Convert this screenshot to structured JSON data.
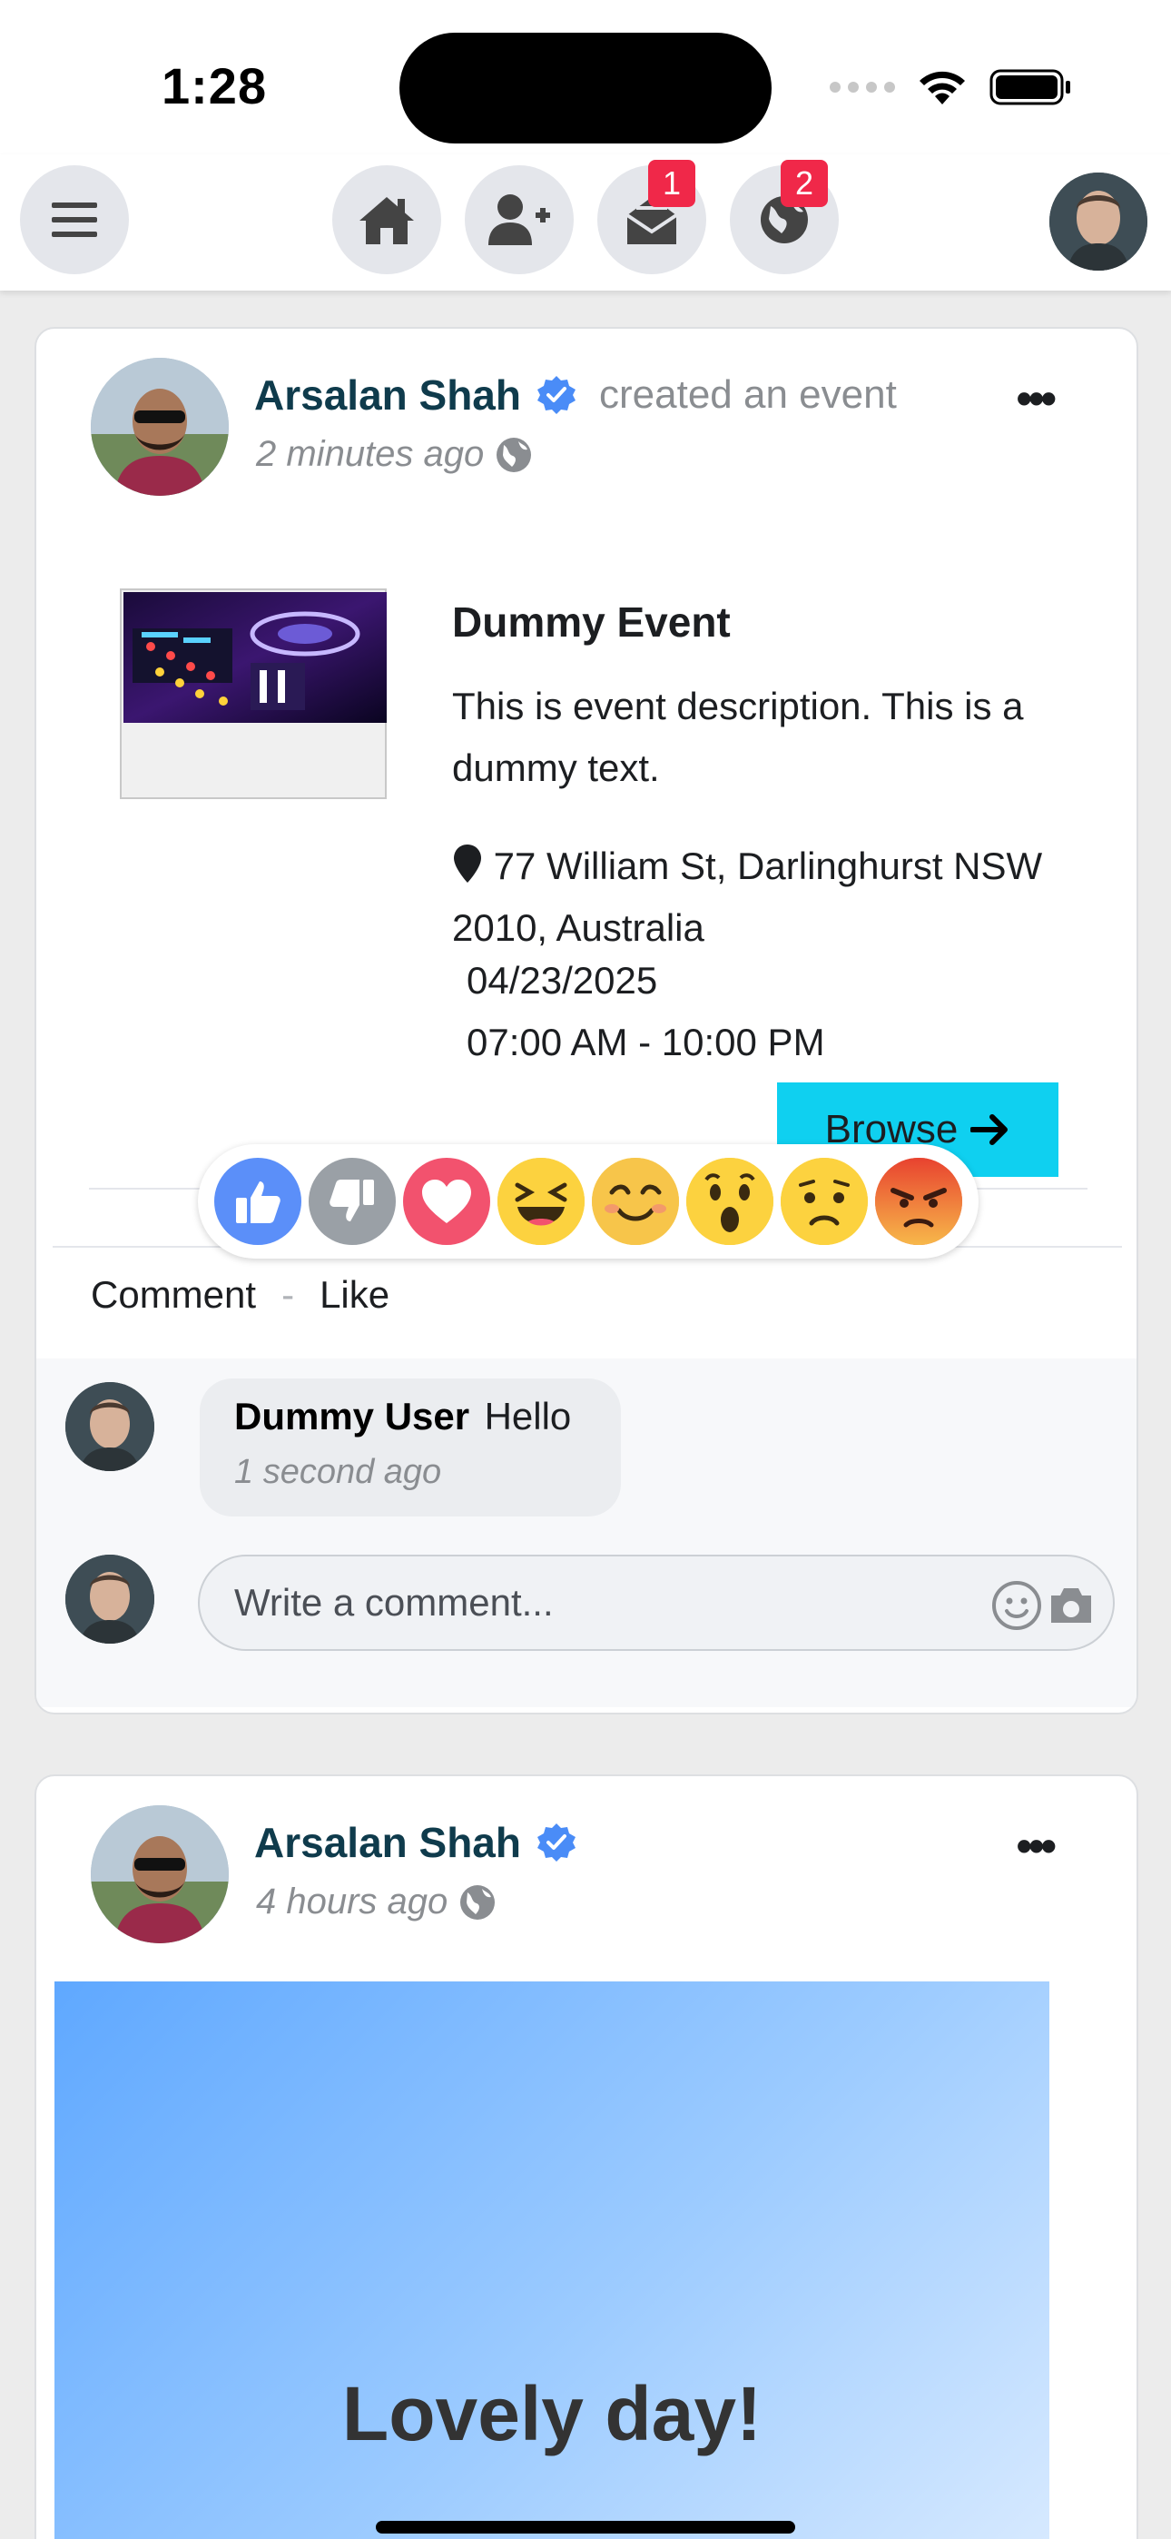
{
  "status": {
    "time": "1:28"
  },
  "nav": {
    "items": [
      {
        "name": "home",
        "badge": ""
      },
      {
        "name": "friend-requests",
        "badge": ""
      },
      {
        "name": "messages",
        "badge": "1"
      },
      {
        "name": "notifications",
        "badge": "2"
      }
    ]
  },
  "posts": [
    {
      "author": "Arsalan Shah",
      "action": "created an event",
      "time": "2 minutes ago",
      "event": {
        "title": "Dummy Event",
        "description": "This is event description. This is a dummy text.",
        "location": "77 William St, Darlinghurst NSW 2010, Australia",
        "date": "04/23/2025",
        "time_range": "07:00 AM - 10:00 PM",
        "button_label": "Browse"
      },
      "reactions": [
        "like",
        "dislike",
        "love",
        "haha",
        "smile",
        "wow",
        "sad",
        "angry"
      ],
      "actions": {
        "comment": "Comment",
        "separator": "-",
        "like": "Like"
      },
      "comments": [
        {
          "user": "Dummy User",
          "text": "Hello",
          "time": "1 second ago"
        }
      ],
      "comment_input": {
        "placeholder": "Write a comment..."
      }
    },
    {
      "author": "Arsalan Shah",
      "time": "4 hours ago",
      "background_text": "Lovely day!"
    }
  ],
  "colors": {
    "accent": "#0fd0f0",
    "author_name": "#0f3b4c",
    "badge": "#f02849",
    "verified": "#4a8cf7",
    "muted": "#8a8d91"
  }
}
